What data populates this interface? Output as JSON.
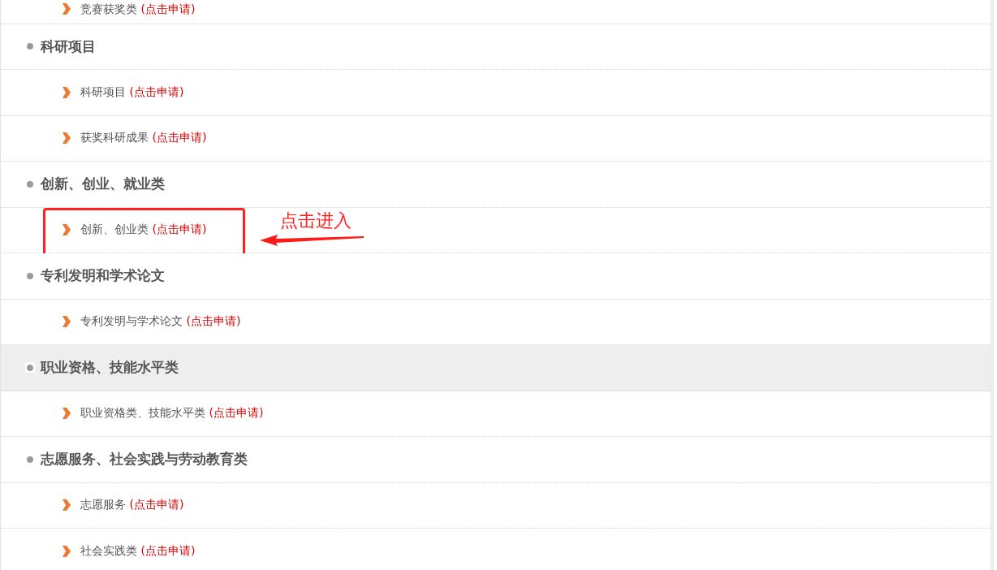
{
  "items": [
    {
      "kind": "link",
      "label": "竞赛获奖类",
      "action": "(点击申请)",
      "callout": false
    },
    {
      "kind": "section",
      "label": "科研项目",
      "highlighted": false
    },
    {
      "kind": "link",
      "label": "科研项目",
      "action": "(点击申请)",
      "callout": false
    },
    {
      "kind": "link",
      "label": "获奖科研成果",
      "action": "(点击申请)",
      "callout": false
    },
    {
      "kind": "section",
      "label": "创新、创业、就业类",
      "highlighted": false
    },
    {
      "kind": "link",
      "label": "创新、创业类",
      "action": "(点击申请)",
      "callout": true
    },
    {
      "kind": "section",
      "label": "专利发明和学术论文",
      "highlighted": false
    },
    {
      "kind": "link",
      "label": "专利发明与学术论文",
      "action": "(点击申请)",
      "callout": false
    },
    {
      "kind": "section",
      "label": "职业资格、技能水平类",
      "highlighted": true
    },
    {
      "kind": "link",
      "label": "职业资格类、技能水平类",
      "action": "(点击申请)",
      "callout": false
    },
    {
      "kind": "section",
      "label": "志愿服务、社会实践与劳动教育类",
      "highlighted": false
    },
    {
      "kind": "link",
      "label": "志愿服务",
      "action": "(点击申请)",
      "callout": false
    },
    {
      "kind": "link",
      "label": "社会实践类",
      "action": "(点击申请)",
      "callout": false
    }
  ],
  "annotation": {
    "text": "点击进入"
  }
}
